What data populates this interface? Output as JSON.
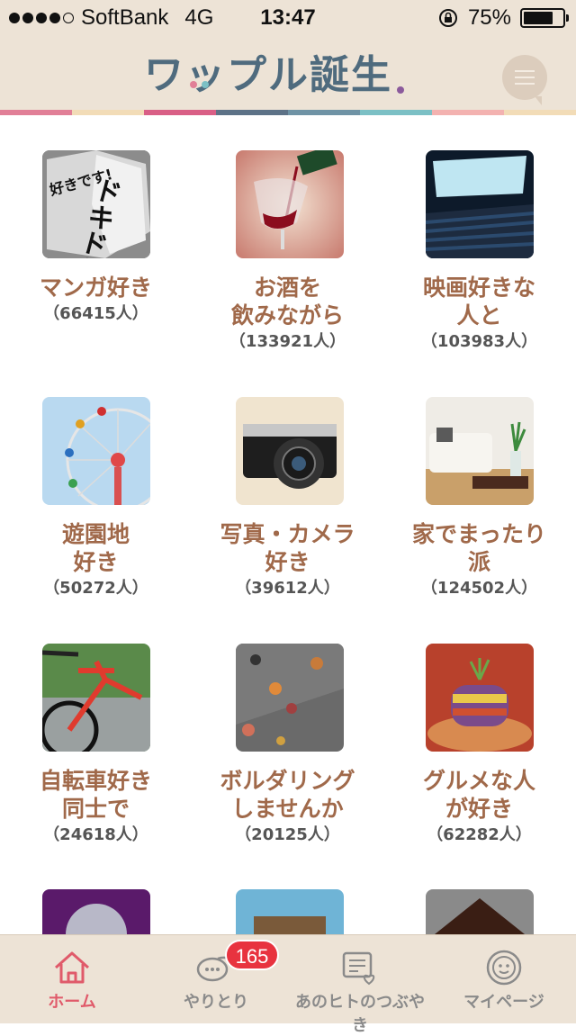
{
  "status_bar": {
    "carrier": "SoftBank",
    "network": "4G",
    "time": "13:47",
    "battery_text": "75%",
    "battery_level": 0.75,
    "signal_bars": 4,
    "signal_max": 5
  },
  "header": {
    "logo_text": "ワップル誕生",
    "menu_icon": "hamburger-menu-icon",
    "stripe_colors": [
      "#e17f97",
      "#f2dcb7",
      "#d95f86",
      "#5d7287",
      "#6f93a5",
      "#7cc0c5",
      "#f3b2b0",
      "#f2dcb7"
    ]
  },
  "communities": [
    {
      "title": "マンガ好き",
      "count": "（66415人）",
      "image": "manga-image"
    },
    {
      "title": "お酒を\n飲みながら",
      "count": "（133921人）",
      "image": "wine-image"
    },
    {
      "title": "映画好きな\n人と",
      "count": "（103983人）",
      "image": "cinema-image"
    },
    {
      "title": "遊園地\n好き",
      "count": "（50272人）",
      "image": "ferris-wheel-image"
    },
    {
      "title": "写真・カメラ\n好き",
      "count": "（39612人）",
      "image": "camera-image"
    },
    {
      "title": "家でまったり\n派",
      "count": "（124502人）",
      "image": "sofa-image"
    },
    {
      "title": "自転車好き\n同士で",
      "count": "（24618人）",
      "image": "bicycle-image"
    },
    {
      "title": "ボルダリング\nしませんか",
      "count": "（20125人）",
      "image": "bouldering-image"
    },
    {
      "title": "グルメな人\nが好き",
      "count": "（62282人）",
      "image": "gourmet-image"
    },
    {
      "title": "",
      "count": "",
      "image": "microphone-image"
    },
    {
      "title": "",
      "count": "",
      "image": "beach-image"
    },
    {
      "title": "",
      "count": "",
      "image": "chocolate-image"
    }
  ],
  "manga_thumb_text": {
    "left": "好きです!",
    "right": "ドキドキ"
  },
  "tabbar": {
    "tabs": [
      {
        "label": "ホーム",
        "icon": "home-icon",
        "active": true
      },
      {
        "label": "やりとり",
        "icon": "chat-bubbles-icon",
        "active": false
      },
      {
        "label": "あのヒトのつぶやき",
        "icon": "tweet-heart-icon",
        "active": false
      },
      {
        "label": "マイページ",
        "icon": "smiley-face-icon",
        "active": false
      }
    ],
    "badge_count": "165"
  },
  "colors": {
    "header_bg": "#ede3d6",
    "title_color": "#a0694a",
    "active_tab": "#e05a6a",
    "badge": "#e8333f"
  }
}
